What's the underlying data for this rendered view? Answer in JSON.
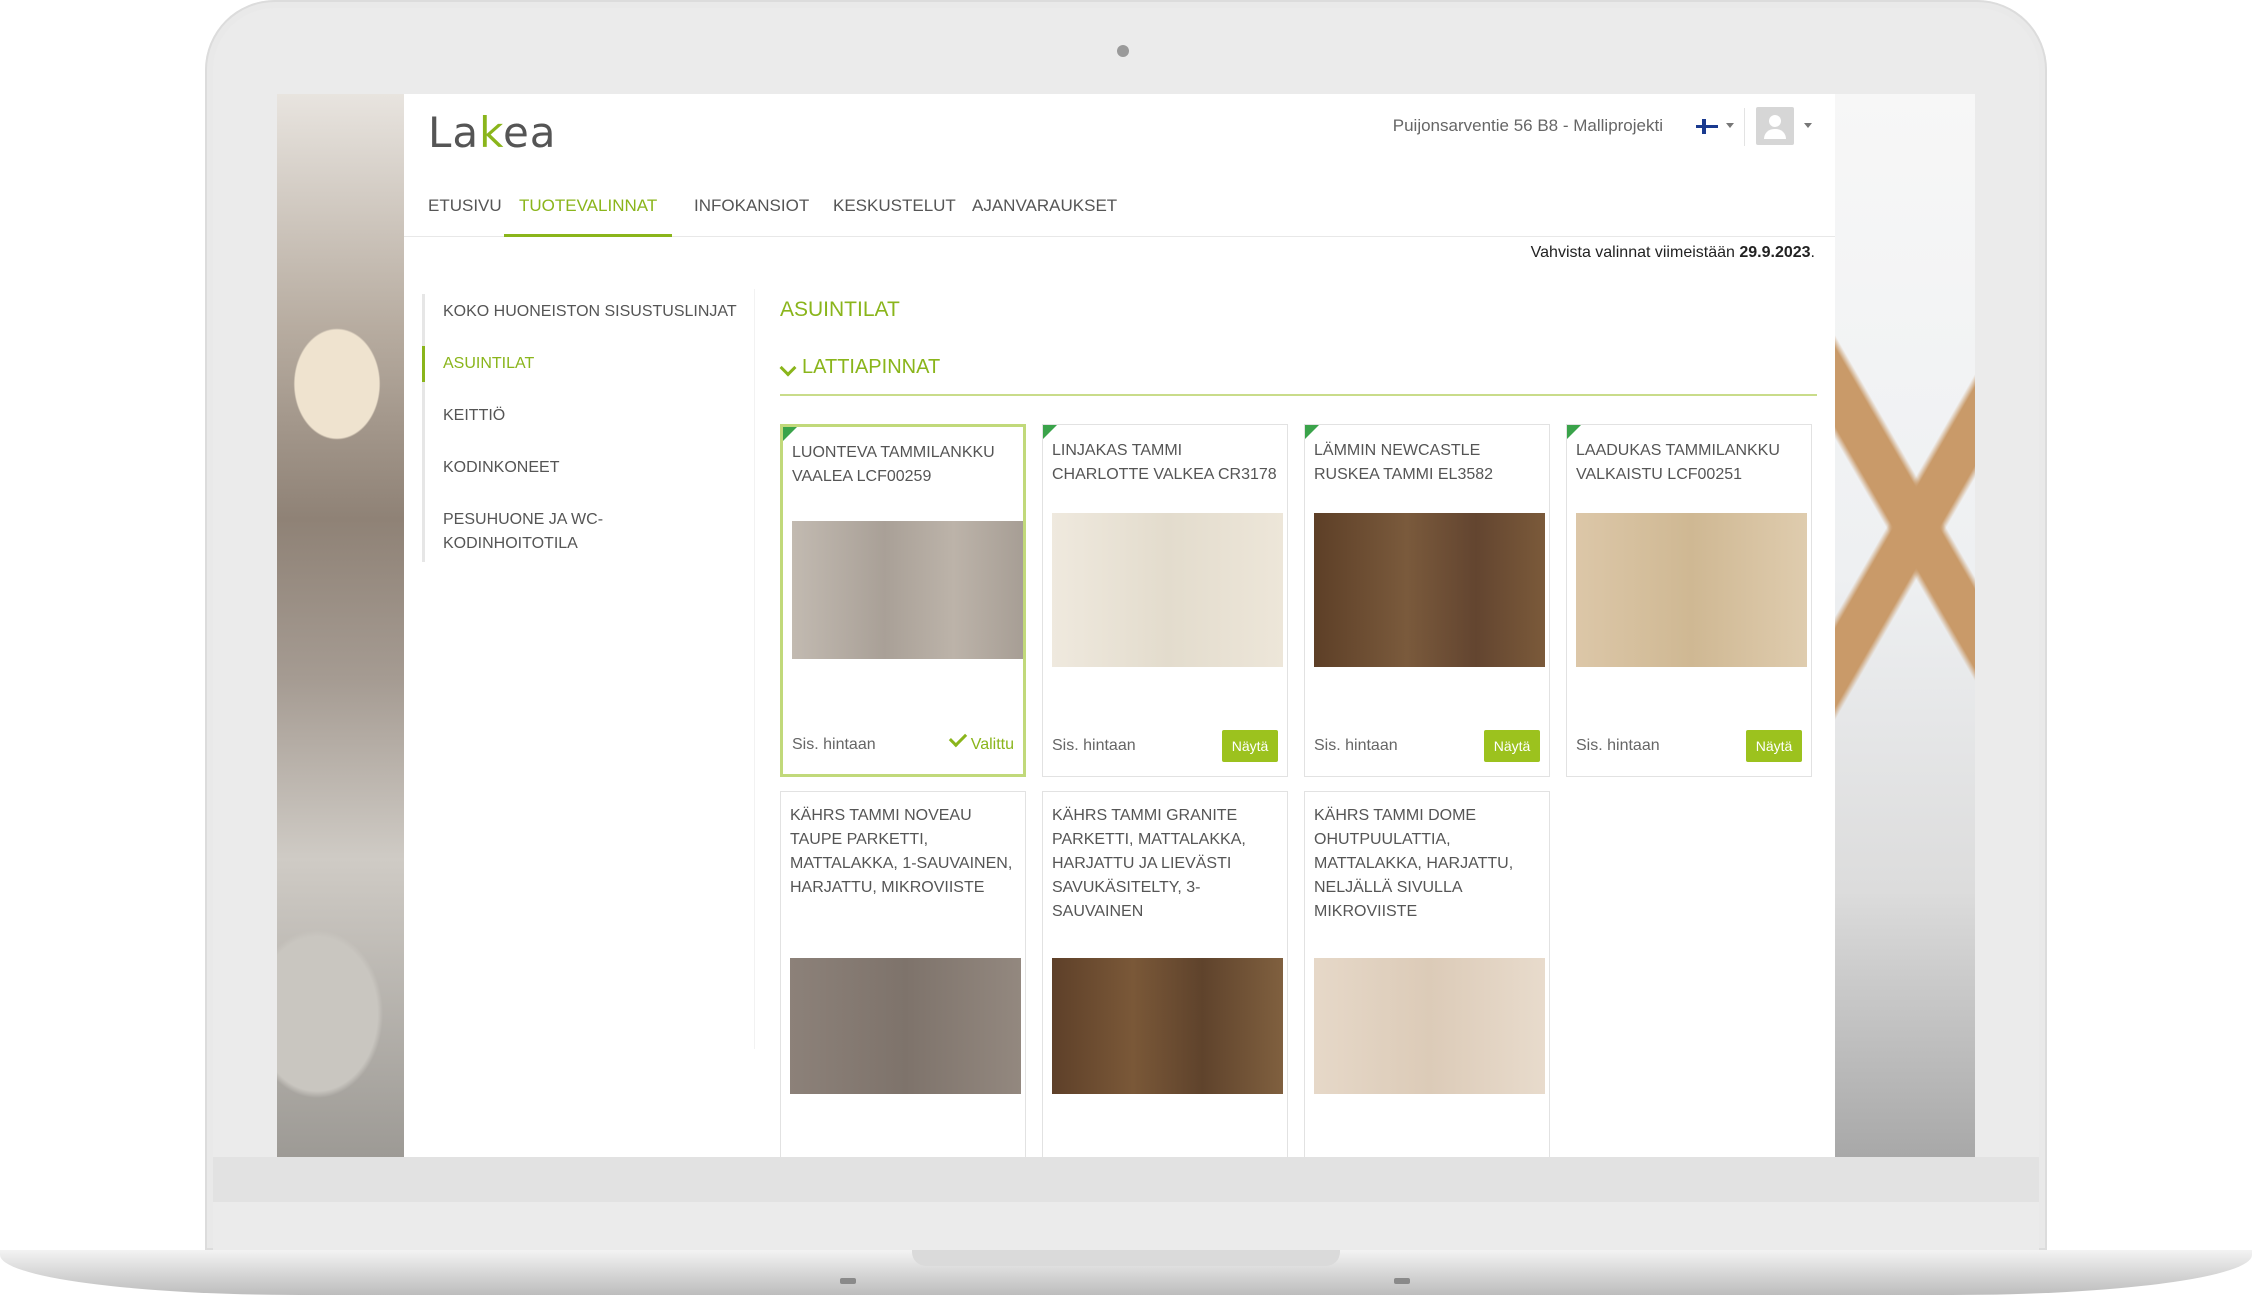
{
  "header": {
    "logo": "lakea",
    "project": "Puijonsarventie 56 B8 - Malliprojekti",
    "language_icon": "finnish-flag-icon",
    "user_icon": "user-avatar-icon"
  },
  "nav": {
    "items": [
      {
        "label": "ETUSIVU"
      },
      {
        "label": "TUOTEVALINNAT"
      },
      {
        "label": "INFOKANSIOT"
      },
      {
        "label": "KESKUSTELUT"
      },
      {
        "label": "AJANVARAUKSET"
      }
    ],
    "active": "TUOTEVALINNAT"
  },
  "deadline": {
    "prefix": "Vahvista valinnat viimeistään",
    "date": "29.9.2023",
    "suffix": "."
  },
  "sidebar": {
    "items": [
      {
        "label": "KOKO HUONEISTON SISUSTUSLINJAT"
      },
      {
        "label": "ASUINTILAT"
      },
      {
        "label": "KEITTIÖ"
      },
      {
        "label": "KODINKONEET"
      },
      {
        "label": "PESUHUONE JA WC-KODINHOITOTILA"
      }
    ],
    "active": "ASUINTILAT"
  },
  "main": {
    "section_title": "ASUINTILAT",
    "subsection_title": "LATTIAPINNAT",
    "products": [
      {
        "title": "LUONTEVA TAMMILANKKU VAALEA LCF00259",
        "price": "Sis. hintaan",
        "selected_label": "Valittu",
        "color": "#b7aea5"
      },
      {
        "title": "LINJAKAS TAMMI CHARLOTTE VALKEA CR3178",
        "price": "Sis. hintaan",
        "button": "Näytä",
        "color": "#ebe4d7"
      },
      {
        "title": "LÄMMIN NEWCASTLE RUSKEA TAMMI EL3582",
        "price": "Sis. hintaan",
        "button": "Näytä",
        "color": "#6e4f33"
      },
      {
        "title": "LAADUKAS TAMMILANKKU VALKAISTU LCF00251",
        "price": "Sis. hintaan",
        "button": "Näytä",
        "color": "#d9c4a4"
      },
      {
        "title": "KÄHRS TAMMI NOVEAU TAUPE PARKETTI, MATTALAKKA, 1-SAUVAINEN, HARJATTU, MIKROVIISTE",
        "color": "#8a7f77"
      },
      {
        "title": "KÄHRS TAMMI GRANITE PARKETTI, MATTALAKKA, HARJATTU JA LIEVÄSTI SAVUKÄSITELTY, 3-SAUVAINEN",
        "color": "#6d4e33"
      },
      {
        "title": "KÄHRS TAMMI DOME OHUTPUULATTIA, MATTALAKKA, HARJATTU, NELJÄLLÄ SIVULLA MIKROVIISTE",
        "color": "#e2d3c2"
      }
    ]
  },
  "colors": {
    "accent": "#8ab51b",
    "button": "#9cc21e",
    "new_corner": "#3aa34a"
  }
}
